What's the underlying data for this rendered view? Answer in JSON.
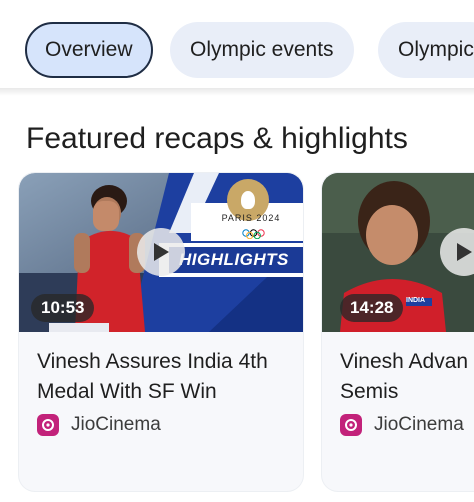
{
  "tabs": [
    {
      "label": "Overview",
      "active": true
    },
    {
      "label": "Olympic events",
      "active": false
    },
    {
      "label": "Olympic",
      "active": false
    }
  ],
  "section": {
    "title": "Featured recaps & highlights"
  },
  "cards": [
    {
      "title": "Vinesh Assures India 4th Medal With SF Win",
      "duration": "10:53",
      "source": "JioCinema",
      "logo_text": "PARIS 2024",
      "banner_text": "HIGHLIGHTS"
    },
    {
      "title": "Vinesh Advan\nSemis",
      "duration": "14:28",
      "source": "JioCinema",
      "jersey_text": "INDIA"
    }
  ],
  "colors": {
    "chip_bg": "#e9eef8",
    "chip_active_bg": "#d6e4fb",
    "brand_blue": "#1d3fa0",
    "source_icon": "#c2227a"
  }
}
